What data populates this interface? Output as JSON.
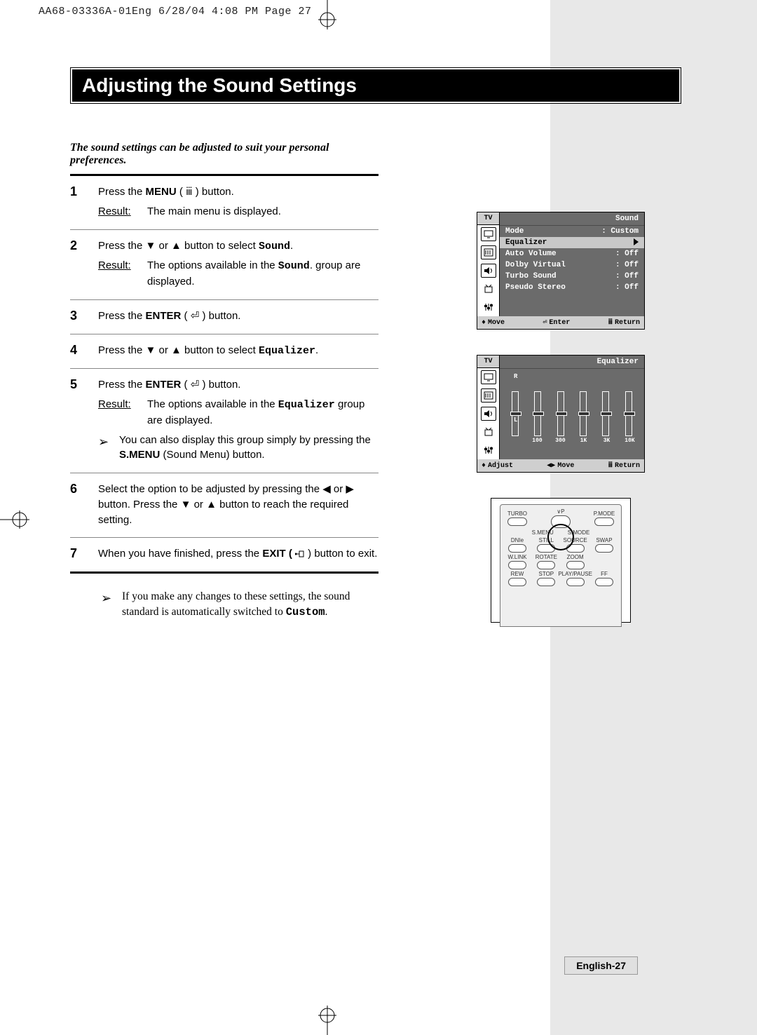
{
  "header": "AA68-03336A-01Eng  6/28/04  4:08 PM  Page 27",
  "title": "Adjusting the Sound Settings",
  "intro": "The sound settings can be adjusted to suit your personal preferences.",
  "steps": {
    "s1": {
      "num": "1",
      "line1_a": "Press the ",
      "line1_b": "MENU",
      "line1_c": " ( ⅲ ) button.",
      "result_lbl": "Result:",
      "result_txt": "The main menu is displayed."
    },
    "s2": {
      "num": "2",
      "line1_a": "Press the ▼ or ▲ button to select ",
      "line1_b": "Sound",
      "line1_c": ".",
      "result_lbl": "Result:",
      "result_txt_a": "The options available in the ",
      "result_txt_b": "Sound",
      "result_txt_c": ". group are displayed."
    },
    "s3": {
      "num": "3",
      "line1_a": "Press the ",
      "line1_b": "ENTER",
      "line1_c": " ( ⏎ ) button."
    },
    "s4": {
      "num": "4",
      "line1_a": "Press the ▼ or ▲ button to select ",
      "line1_b": "Equalizer",
      "line1_c": "."
    },
    "s5": {
      "num": "5",
      "line1_a": "Press the ",
      "line1_b": "ENTER",
      "line1_c": " ( ⏎ ) button.",
      "result_lbl": "Result:",
      "result_txt_a": "The options available in the ",
      "result_txt_b": "Equalizer",
      "result_txt_c": " group are displayed.",
      "note_a": "You can also display this group simply by pressing the ",
      "note_b": "S.MENU",
      "note_c": " (Sound Menu) button."
    },
    "s6": {
      "num": "6",
      "line1": "Select the option to be adjusted by pressing the ◀ or ▶ button. Press the ▼ or ▲ button to reach the required setting."
    },
    "s7": {
      "num": "7",
      "line1_a": "When you have finished, press the ",
      "line1_b": "EXIT ( ",
      "line1_c": " ) button to exit."
    }
  },
  "footnote_a": "If you make any changes to these settings, the sound standard is automatically switched to ",
  "footnote_b": "Custom",
  "footnote_c": ".",
  "osd1": {
    "tv": "TV",
    "title": "Sound",
    "rows": [
      {
        "l": "Mode",
        "r": ": Custom"
      },
      {
        "l": "Equalizer",
        "r": "▶"
      },
      {
        "l": "Auto Volume",
        "r": ": Off"
      },
      {
        "l": "Dolby Virtual",
        "r": ": Off"
      },
      {
        "l": "Turbo Sound",
        "r": ": Off"
      },
      {
        "l": "Pseudo Stereo",
        "r": ": Off"
      }
    ],
    "foot": {
      "move": "Move",
      "enter": "Enter",
      "ret": "Return"
    }
  },
  "osd2": {
    "tv": "TV",
    "title": "Equalizer",
    "r": "R",
    "l": "L",
    "labels": [
      "",
      "100",
      "300",
      "1K",
      "3K",
      "10K"
    ],
    "foot": {
      "adjust": "Adjust",
      "move": "Move",
      "ret": "Return"
    }
  },
  "remote": {
    "r1": [
      "TURBO",
      "∨P",
      "P.MODE"
    ],
    "r1b": [
      "S.MENU",
      "S.MODE"
    ],
    "r2": [
      "DNIe",
      "STILL",
      "SOURCE",
      "SWAP"
    ],
    "r3": [
      "W.LINK",
      "ROTATE",
      "ZOOM",
      ""
    ],
    "r4": [
      "REW",
      "STOP",
      "PLAY/PAUSE",
      "FF"
    ]
  },
  "page_num": "English-27",
  "arrow": "➢"
}
